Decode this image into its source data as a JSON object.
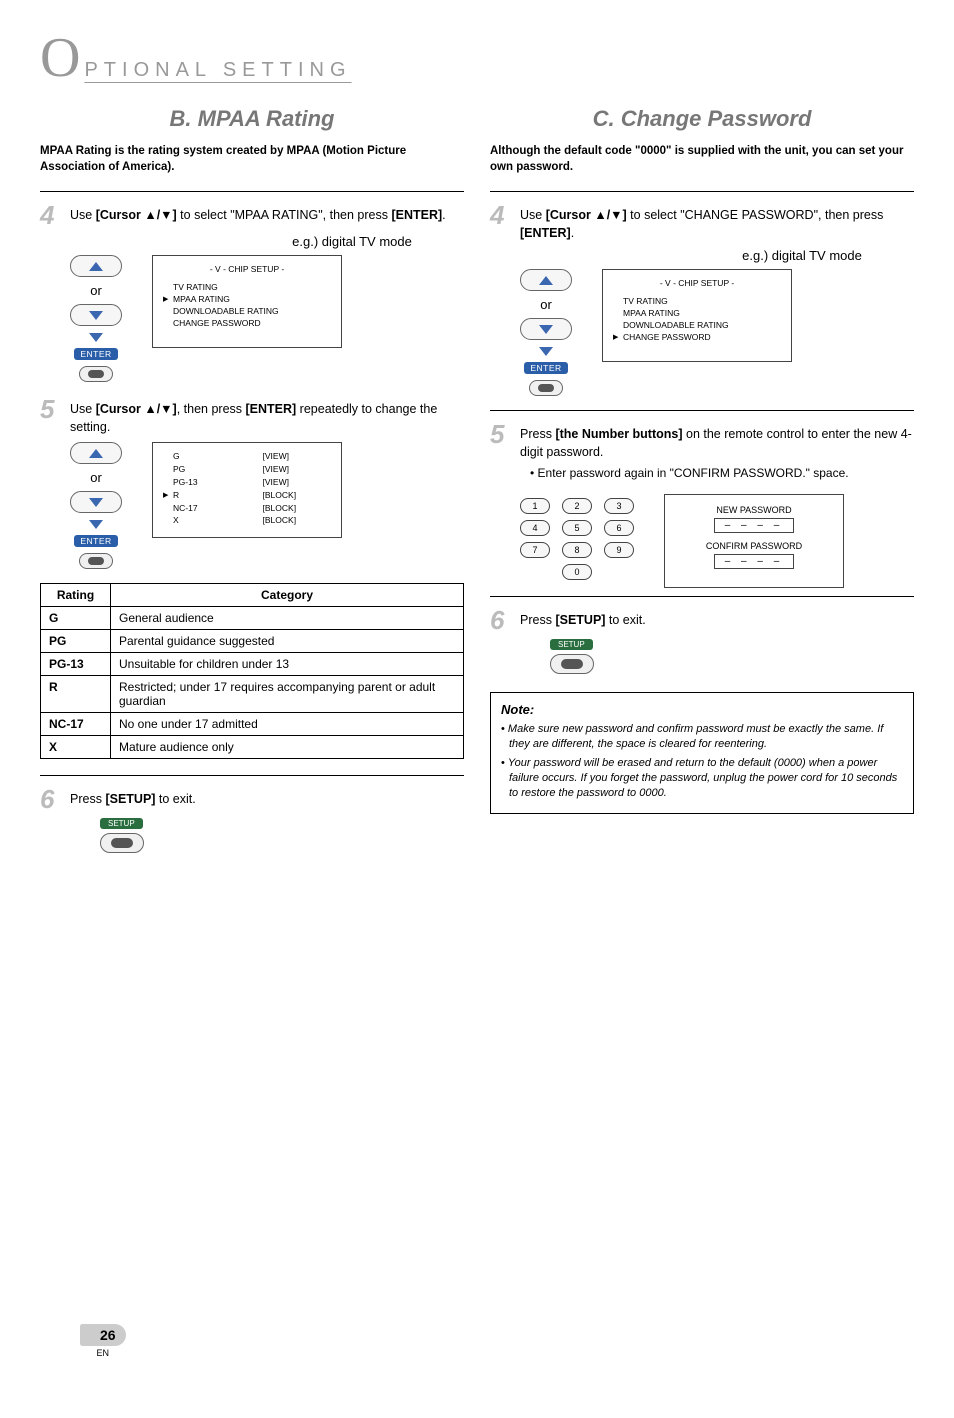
{
  "header": {
    "big_letter": "O",
    "title": "PTIONAL  SETTING"
  },
  "left": {
    "section_title": "B.  MPAA Rating",
    "intro": "MPAA Rating is the rating system created by MPAA (Motion Picture Association of America).",
    "step4": {
      "num": "4",
      "text_pre": "Use ",
      "cursor_label": "[Cursor ▲/▼]",
      "text_mid": " to select \"MPAA RATING\", then press ",
      "enter_label": "[ENTER]",
      "text_post": ".",
      "eg": "e.g.) digital TV mode",
      "or": "or",
      "enter_btn": "ENTER",
      "osd_title": "- V - CHIP SETUP -",
      "osd_items": [
        "TV RATING",
        "MPAA RATING",
        "DOWNLOADABLE RATING",
        "CHANGE PASSWORD"
      ],
      "osd_sel": 1
    },
    "step5": {
      "num": "5",
      "text_pre": "Use ",
      "cursor_label": "[Cursor ▲/▼]",
      "text_mid": ", then press ",
      "enter_label": "[ENTER]",
      "text_post": " repeatedly to change the setting.",
      "or": "or",
      "enter_btn": "ENTER",
      "osd_rows": [
        {
          "rating": "G",
          "state": "[VIEW]"
        },
        {
          "rating": "PG",
          "state": "[VIEW]"
        },
        {
          "rating": "PG-13",
          "state": "[VIEW]"
        },
        {
          "rating": "R",
          "state": "[BLOCK]"
        },
        {
          "rating": "NC-17",
          "state": "[BLOCK]"
        },
        {
          "rating": "X",
          "state": "[BLOCK]"
        }
      ],
      "osd_sel": 3
    },
    "table": {
      "head_rating": "Rating",
      "head_category": "Category",
      "rows": [
        {
          "r": "G",
          "c": "General audience"
        },
        {
          "r": "PG",
          "c": "Parental guidance suggested"
        },
        {
          "r": "PG-13",
          "c": "Unsuitable for children under 13"
        },
        {
          "r": "R",
          "c": "Restricted; under 17 requires accompanying parent or adult guardian"
        },
        {
          "r": "NC-17",
          "c": "No one under 17 admitted"
        },
        {
          "r": "X",
          "c": "Mature audience only"
        }
      ]
    },
    "step6": {
      "num": "6",
      "text_pre": "Press ",
      "setup_label": "[SETUP]",
      "text_post": " to exit.",
      "setup_btn": "SETUP"
    }
  },
  "right": {
    "section_title": "C.  Change Password",
    "intro": "Although the default code \"0000\" is supplied with the unit, you can set your own password.",
    "step4": {
      "num": "4",
      "text_pre": "Use ",
      "cursor_label": "[Cursor ▲/▼]",
      "text_mid": " to select \"CHANGE PASSWORD\", then press ",
      "enter_label": "[ENTER]",
      "text_post": ".",
      "eg": "e.g.) digital TV mode",
      "or": "or",
      "enter_btn": "ENTER",
      "osd_title": "- V - CHIP SETUP -",
      "osd_items": [
        "TV RATING",
        "MPAA RATING",
        "DOWNLOADABLE RATING",
        "CHANGE PASSWORD"
      ],
      "osd_sel": 3
    },
    "step5": {
      "num": "5",
      "text_pre": "Press ",
      "num_label": "[the Number buttons]",
      "text_post": " on the remote control to enter the new 4-digit password.",
      "bullet": "Enter password again in \"CONFIRM PASSWORD.\" space.",
      "pw_new": "NEW PASSWORD",
      "pw_confirm": "CONFIRM PASSWORD",
      "dashes": "– – – –"
    },
    "step6": {
      "num": "6",
      "text_pre": "Press ",
      "setup_label": "[SETUP]",
      "text_post": " to exit.",
      "setup_btn": "SETUP"
    },
    "note": {
      "heading": "Note:",
      "items": [
        "Make sure new password and confirm password must be exactly the same. If they are different, the space is cleared for reentering.",
        "Your password will be erased and return to the default (0000) when a power failure occurs. If you forget the password, unplug the power cord for 10 seconds to restore the password to 0000."
      ]
    }
  },
  "keypad": [
    "1",
    "2",
    "3",
    "4",
    "5",
    "6",
    "7",
    "8",
    "9",
    "0"
  ],
  "footer": {
    "page": "26",
    "lang": "EN"
  }
}
